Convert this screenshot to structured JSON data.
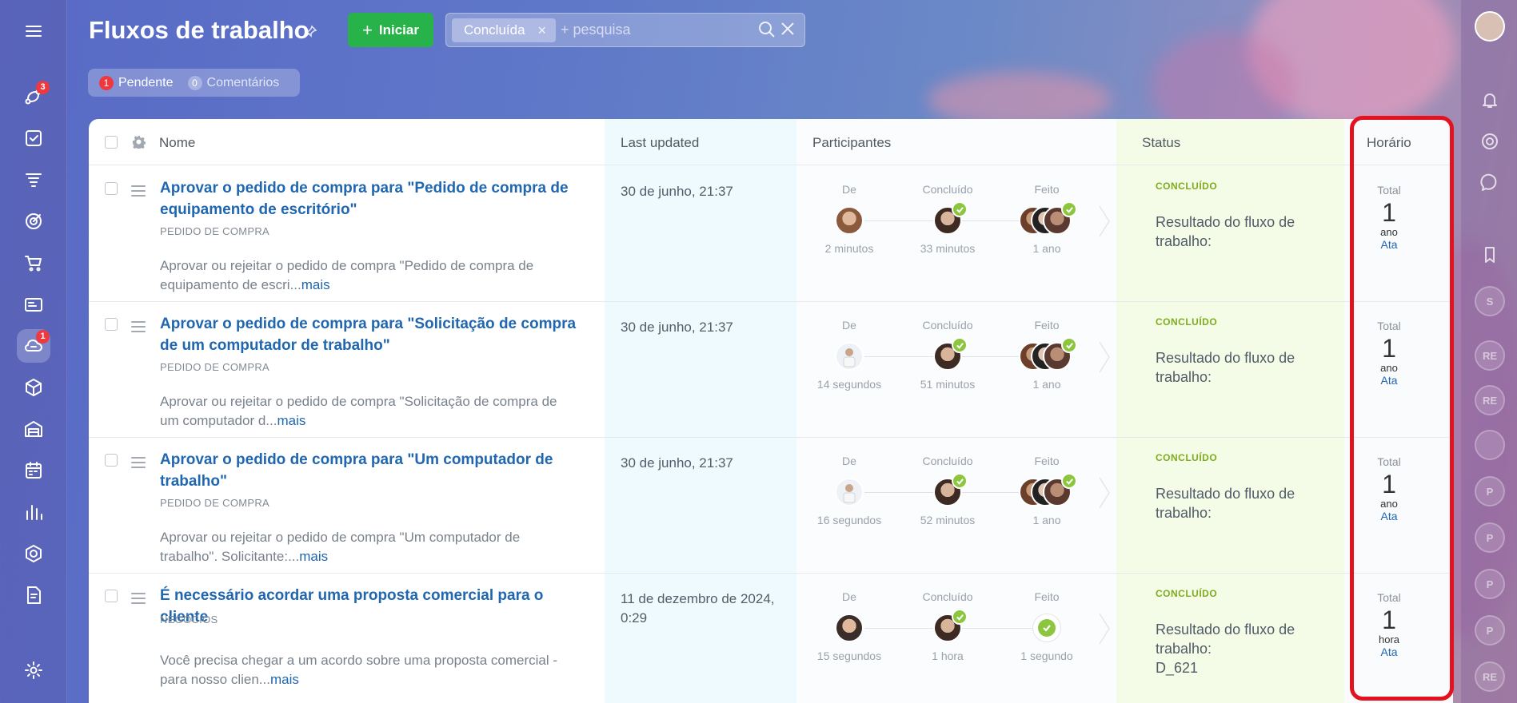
{
  "header": {
    "title": "Fluxos de trabalho",
    "start_label": "Iniciar",
    "filter_chip": "Concluída",
    "search_placeholder": "+ pesquisa"
  },
  "counters": [
    {
      "count": "1",
      "label": "Pendente"
    },
    {
      "count": "0",
      "label": "Comentários"
    }
  ],
  "left_nav": {
    "badges": {
      "activity": "3",
      "workflows": "1"
    }
  },
  "columns": {
    "name": "Nome",
    "updated": "Last updated",
    "participants": "Participantes",
    "status": "Status",
    "time": "Horário"
  },
  "participant_stages": {
    "from": "De",
    "completed": "Concluído",
    "done": "Feito"
  },
  "rows": [
    {
      "name": "Aprovar o pedido de compra para \"Pedido de compra de equipamento de escritório\"",
      "type": "PEDIDO DE COMPRA",
      "desc": "Aprovar ou rejeitar o pedido de compra \"Pedido de compra de equipamento de escri...",
      "more": "mais",
      "updated": "30 de junho, 21:37",
      "t_from": "2 minutos",
      "t_completed": "33 minutos",
      "t_done": "1 ano",
      "status_label": "CONCLUÍDO",
      "status_text": "Resultado do fluxo de trabalho:",
      "status_extra": "",
      "time_total": "Total",
      "time_value": "1",
      "time_unit": "ano",
      "time_link": "Ata"
    },
    {
      "name": "Aprovar o pedido de compra para \"Solicitação de compra de um computador de trabalho\"",
      "type": "PEDIDO DE COMPRA",
      "desc": "Aprovar ou rejeitar o pedido de compra \"Solicitação de compra de um computador d...",
      "more": "mais",
      "updated": "30 de junho, 21:37",
      "t_from": "14 segundos",
      "t_completed": "51 minutos",
      "t_done": "1 ano",
      "status_label": "CONCLUÍDO",
      "status_text": "Resultado do fluxo de trabalho:",
      "status_extra": "",
      "time_total": "Total",
      "time_value": "1",
      "time_unit": "ano",
      "time_link": "Ata"
    },
    {
      "name": "Aprovar o pedido de compra para \"Um computador de trabalho\"",
      "type": "PEDIDO DE COMPRA",
      "desc": "Aprovar ou rejeitar o pedido de compra \"Um computador de trabalho\". Solicitante:...",
      "more": "mais",
      "updated": "30 de junho, 21:37",
      "t_from": "16 segundos",
      "t_completed": "52 minutos",
      "t_done": "1 ano",
      "status_label": "CONCLUÍDO",
      "status_text": "Resultado do fluxo de trabalho:",
      "status_extra": "",
      "time_total": "Total",
      "time_value": "1",
      "time_unit": "ano",
      "time_link": "Ata"
    },
    {
      "name": "É necessário acordar uma proposta comercial para o cliente",
      "type": "NEGÓCIOS",
      "desc": "Você precisa chegar a um acordo sobre uma proposta comercial - para nosso clien...",
      "more": "mais",
      "updated": "11 de dezembro de 2024, 0:29",
      "t_from": "15 segundos",
      "t_completed": "1 hora",
      "t_done": "1 segundo",
      "status_label": "CONCLUÍDO",
      "status_text": "Resultado do fluxo de trabalho:",
      "status_extra": "D_621",
      "time_total": "Total",
      "time_value": "1",
      "time_unit": "hora",
      "time_link": "Ata"
    }
  ],
  "right_bar": {
    "initials": [
      "S",
      "RE",
      "RE",
      "P",
      "P",
      "P",
      "P",
      "RE"
    ]
  },
  "colors": {
    "accent_green": "#27b24a",
    "link": "#2067b0",
    "status_green": "#7eac1f",
    "highlight_red": "#e4121e"
  }
}
